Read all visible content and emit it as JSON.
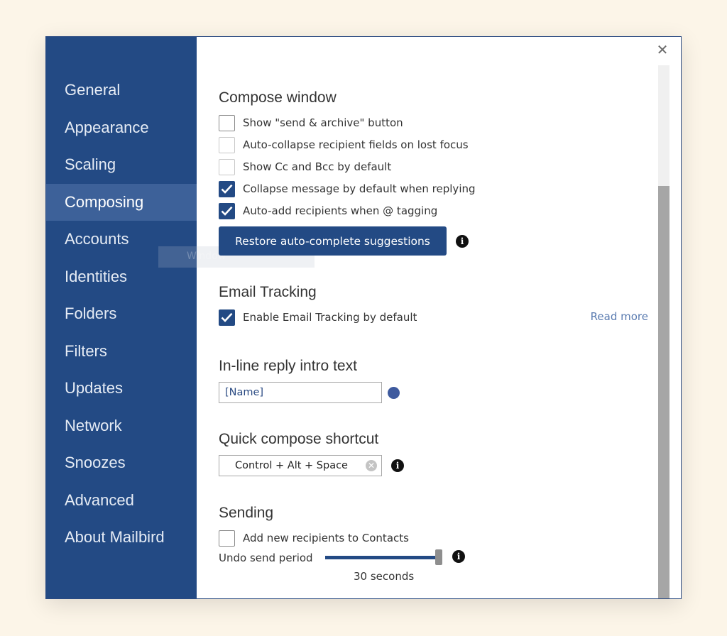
{
  "sidebar": {
    "items": [
      {
        "label": "General"
      },
      {
        "label": "Appearance"
      },
      {
        "label": "Scaling"
      },
      {
        "label": "Composing",
        "active": true
      },
      {
        "label": "Accounts"
      },
      {
        "label": "Identities"
      },
      {
        "label": "Folders"
      },
      {
        "label": "Filters"
      },
      {
        "label": "Updates"
      },
      {
        "label": "Network"
      },
      {
        "label": "Snoozes"
      },
      {
        "label": "Advanced"
      },
      {
        "label": "About Mailbird"
      }
    ],
    "ghost_text": "Window"
  },
  "window": {
    "close_icon": "close-icon"
  },
  "compose": {
    "title": "Compose window",
    "options": [
      {
        "label": "Show \"send & archive\" button",
        "checked": false
      },
      {
        "label": "Auto-collapse recipient fields on lost focus",
        "checked": false
      },
      {
        "label": "Show Cc and Bcc by default",
        "checked": false
      },
      {
        "label": "Collapse message by default when replying",
        "checked": true
      },
      {
        "label": "Auto-add recipients when @ tagging",
        "checked": true
      }
    ],
    "restore_button": "Restore auto-complete suggestions"
  },
  "tracking": {
    "title": "Email Tracking",
    "option": {
      "label": "Enable Email Tracking by default",
      "checked": true
    },
    "read_more": "Read more"
  },
  "reply_intro": {
    "title": "In-line reply intro text",
    "value": "[Name]"
  },
  "shortcut": {
    "title": "Quick compose shortcut",
    "value": "Control + Alt + Space"
  },
  "sending": {
    "title": "Sending",
    "option": {
      "label": "Add new recipients to Contacts",
      "checked": false
    },
    "undo_label": "Undo send period",
    "undo_value": "30 seconds"
  },
  "colors": {
    "sidebar": "#234a84",
    "sidebar_active": "#3d6199",
    "accent": "#234a84",
    "link": "#5a7bb0",
    "background": "#fcf5e8"
  }
}
